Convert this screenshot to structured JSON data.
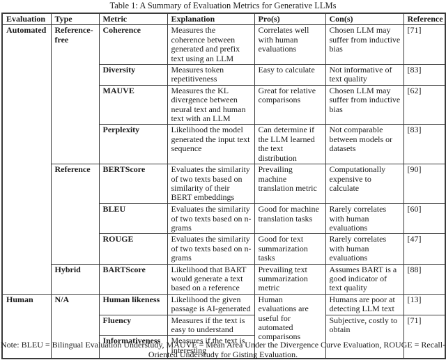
{
  "caption": "Table 1: A Summary of Evaluation Metrics for Generative LLMs",
  "headers": [
    "Evaluation",
    "Type",
    "Metric",
    "Explanation",
    "Pro(s)",
    "Con(s)",
    "Reference"
  ],
  "evaluations": {
    "automated": "Automated",
    "human": "Human"
  },
  "types": {
    "reference_free": "Reference-free",
    "reference": "Reference",
    "hybrid": "Hybrid",
    "na": "N/A"
  },
  "rows": [
    {
      "metric": "Coherence",
      "explanation": "Measures the coherence between generated and prefix text using an LLM",
      "pros": "Correlates well with human evaluations",
      "cons": "Chosen LLM may suffer from inductive bias",
      "reference": "[71]"
    },
    {
      "metric": "Diversity",
      "explanation": "Measures token repetitiveness",
      "pros": "Easy to calculate",
      "cons": "Not informative of text quality",
      "reference": "[83]"
    },
    {
      "metric": "MAUVE",
      "explanation": "Measures the KL divergence between neural text and human text with an LLM",
      "pros": "Great for relative comparisons",
      "cons": "Chosen LLM may suffer from inductive bias",
      "reference": "[62]"
    },
    {
      "metric": "Perplexity",
      "explanation": "Likelihood the model generated the input text sequence",
      "pros": "Can determine if the LLM learned the text distribution",
      "cons": "Not comparable between models or datasets",
      "reference": "[83]"
    },
    {
      "metric": "BERTScore",
      "explanation": "Evaluates the similarity of two texts based on similarity of their BERT embeddings",
      "pros": "Prevailing machine translation metric",
      "cons": "Computationally expensive to calculate",
      "reference": "[90]"
    },
    {
      "metric": "BLEU",
      "explanation": "Evaluates the similarity of two texts based on n-grams",
      "pros": "Good for machine translation tasks",
      "cons": "Rarely correlates with human evaluations",
      "reference": "[60]"
    },
    {
      "metric": "ROUGE",
      "explanation": "Evaluates the similarity of two texts based on n-grams",
      "pros": "Good for text summarization tasks",
      "cons": "Rarely correlates with human evaluations",
      "reference": "[47]"
    },
    {
      "metric": "BARTScore",
      "explanation": "Likelihood that BART would generate a text based on a reference",
      "pros": "Prevailing text summarization metric",
      "cons": "Assumes BART is a good indicator of text quality",
      "reference": "[88]"
    },
    {
      "metric": "Human likeness",
      "explanation": "Likelihood the given passage is AI-generated",
      "pros": "Human evaluations are useful for automated comparisons",
      "cons": "Humans are poor at detecting LLM text",
      "reference": "[13]"
    },
    {
      "metric": "Fluency",
      "explanation": "Measures if the text is easy to understand",
      "cons": "Subjective, costly to obtain",
      "reference": "[71]"
    },
    {
      "metric": "Informativeness",
      "explanation": "Measures if the text is interesting"
    }
  ],
  "note": "Note: BLEU = Bilingual Evaluation Understudy, MAUVE = Mean Area Under the Divergence Curve Evaluation, ROUGE = Recall-Oriented Understudy for Gisting Evaluation."
}
